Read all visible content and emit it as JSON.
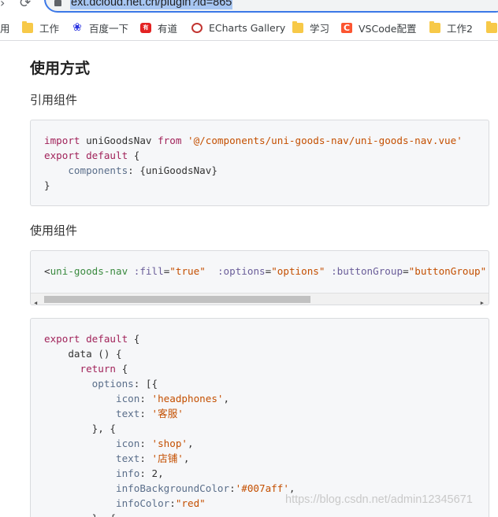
{
  "browser": {
    "url": "ext.dcloud.net.cn/plugin?id=865",
    "bookmarks": [
      {
        "label": "用",
        "icon": "folder-icon"
      },
      {
        "label": "工作",
        "icon": "folder-icon"
      },
      {
        "label": "百度一下",
        "icon": "baidu-icon"
      },
      {
        "label": "有道",
        "icon": "youdao-icon"
      },
      {
        "label": "ECharts Gallery",
        "icon": "echarts-icon"
      },
      {
        "label": "学习",
        "icon": "folder-icon"
      },
      {
        "label": "VSCode配置",
        "icon": "csdn-icon"
      },
      {
        "label": "工作2",
        "icon": "folder-icon"
      }
    ]
  },
  "content": {
    "title": "使用方式",
    "section1": "引用组件",
    "section2": "使用组件",
    "code1": {
      "import_kw": "import",
      "import_name": " uniGoodsNav ",
      "from_kw": "from",
      "path": "'@/components/uni-goods-nav/uni-goods-nav.vue'",
      "export_kw": "export default",
      "open_brace": " {",
      "components_key": "components",
      "components_val": ": {uniGoodsNav}",
      "close_brace": "}"
    },
    "code2": {
      "tag_open": "<",
      "tag_name": "uni-goods-nav",
      "attr_fill": ":fill",
      "val_fill": "\"true\"",
      "attr_options": ":options",
      "val_options": "\"options\"",
      "attr_button_group": ":buttonGroup",
      "val_button_group": "\"buttonGroup\""
    },
    "code3": {
      "export_kw": "export default",
      "open_brace": " {",
      "data_fn": "data () {",
      "return_kw": "return",
      "options_key": "options",
      "options_open": ": [{",
      "icon_key": "icon",
      "icon1": "'headphones'",
      "text_key": "text",
      "text1": "'客服'",
      "item_sep": "}, {",
      "icon2": "'shop'",
      "text2": "'店铺'",
      "info_key": "info",
      "info_val": ": 2,",
      "info_bg_key": "infoBackgroundColor",
      "info_bg_val": "'#007aff'",
      "info_color_key": "infoColor",
      "info_color_val": "\"red\"",
      "item_sep2": "}, {"
    },
    "watermark": "https://blog.csdn.net/admin12345671"
  },
  "colors": {
    "keyword": "#a1235a",
    "string": "#c44f00",
    "property": "#5a6e8a",
    "tag": "#3a8a3f",
    "url_highlight": "#a7c6f2"
  }
}
